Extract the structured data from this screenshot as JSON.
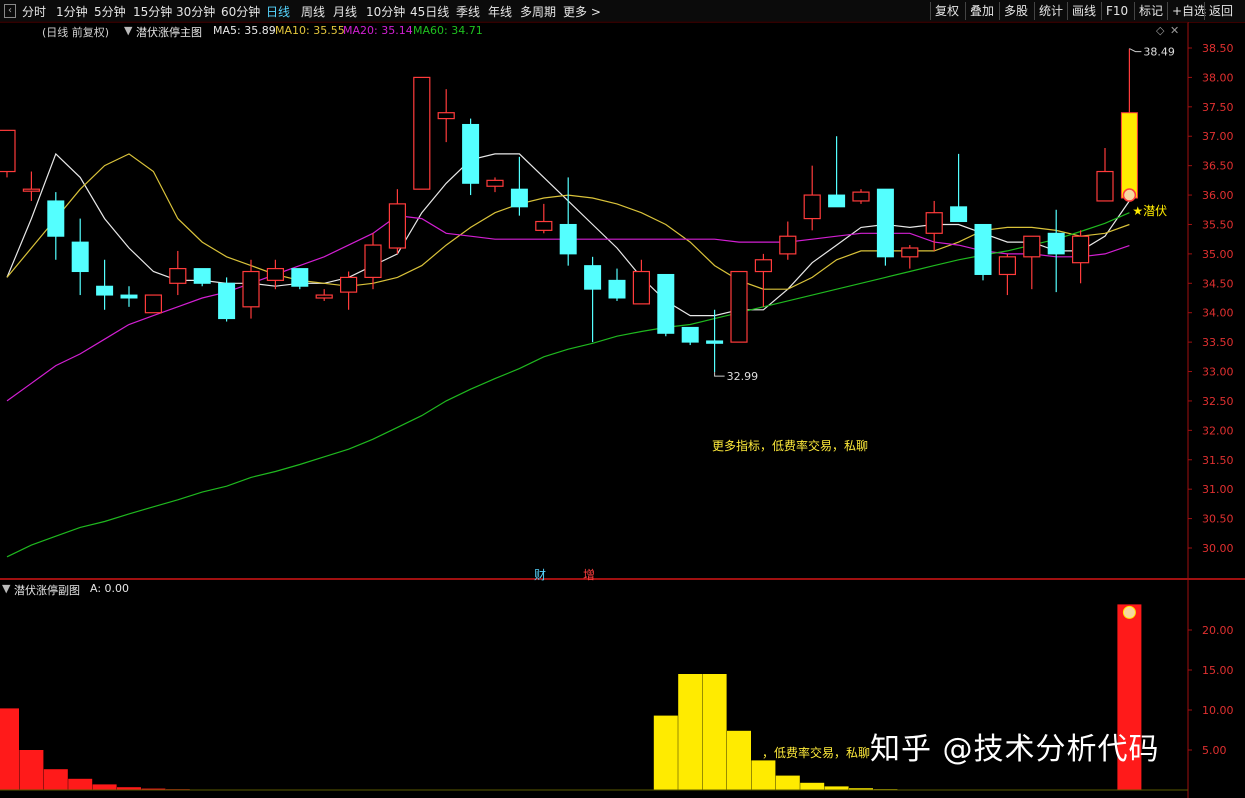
{
  "toolbar": {
    "periods": [
      "分时",
      "1分钟",
      "5分钟",
      "15分钟",
      "30分钟",
      "60分钟",
      "日线",
      "周线",
      "月线",
      "10分钟",
      "45日线",
      "季线",
      "年线",
      "多周期",
      "更多 >"
    ],
    "active_period": "日线",
    "right_buttons": [
      "复权",
      "叠加",
      "多股",
      "统计",
      "画线",
      "F10",
      "标记",
      "+自选",
      "返回"
    ]
  },
  "main_legend": {
    "title": "(日线 前复权)",
    "indicator": "潜伏涨停主图",
    "ma5_label": "MA5: 35.89",
    "ma10_label": "MA10: 35.55",
    "ma20_label": "MA20: 35.14",
    "ma60_label": "MA60: 34.71"
  },
  "sub_legend": {
    "indicator": "潜伏涨停副图",
    "value": "A: 0.00"
  },
  "colors": {
    "up": "#ff3b3b",
    "down": "#54ffff",
    "ma5": "#e8e8e8",
    "ma10": "#d9c23a",
    "ma20": "#d21fd2",
    "ma60": "#1fb81f",
    "signal": "#ffeb00",
    "axis": "#a01010"
  },
  "annotations": {
    "high_label": "38.49",
    "low_label": "32.99",
    "signal_label": "★潜伏",
    "promo_text": "更多指标，低费率交易，私聊",
    "promo_text_sub": "，低费率交易，私聊",
    "marker_cai": "财",
    "marker_zeng": "增",
    "watermark": "知乎 @技术分析代码"
  },
  "chart_data": [
    {
      "type": "candlestick",
      "title": "潜伏涨停主图",
      "ylim": [
        29.6,
        38.75
      ],
      "y_ticks": [
        "38.50",
        "38.00",
        "37.50",
        "37.00",
        "36.50",
        "36.00",
        "35.50",
        "35.00",
        "34.50",
        "34.00",
        "33.50",
        "33.00",
        "32.50",
        "32.00",
        "31.50",
        "31.00",
        "30.50",
        "30.00"
      ],
      "candles": [
        {
          "o": 36.4,
          "h": 37.0,
          "l": 36.3,
          "c": 37.1
        },
        {
          "o": 36.1,
          "h": 36.4,
          "l": 35.9,
          "c": 36.1
        },
        {
          "o": 35.9,
          "h": 36.05,
          "l": 34.9,
          "c": 35.3
        },
        {
          "o": 35.2,
          "h": 35.6,
          "l": 34.3,
          "c": 34.7
        },
        {
          "o": 34.45,
          "h": 34.9,
          "l": 34.05,
          "c": 34.3
        },
        {
          "o": 34.3,
          "h": 34.45,
          "l": 34.1,
          "c": 34.25
        },
        {
          "o": 34.0,
          "h": 34.3,
          "l": 34.0,
          "c": 34.3
        },
        {
          "o": 34.5,
          "h": 35.05,
          "l": 34.3,
          "c": 34.75
        },
        {
          "o": 34.75,
          "h": 34.75,
          "l": 34.45,
          "c": 34.5
        },
        {
          "o": 34.5,
          "h": 34.6,
          "l": 33.85,
          "c": 33.9
        },
        {
          "o": 34.1,
          "h": 34.9,
          "l": 33.9,
          "c": 34.7
        },
        {
          "o": 34.55,
          "h": 34.9,
          "l": 34.4,
          "c": 34.75
        },
        {
          "o": 34.75,
          "h": 34.75,
          "l": 34.4,
          "c": 34.45
        },
        {
          "o": 34.25,
          "h": 34.4,
          "l": 34.2,
          "c": 34.3
        },
        {
          "o": 34.35,
          "h": 34.7,
          "l": 34.05,
          "c": 34.6
        },
        {
          "o": 34.6,
          "h": 35.35,
          "l": 34.4,
          "c": 35.15
        },
        {
          "o": 35.1,
          "h": 36.1,
          "l": 35.0,
          "c": 35.85
        },
        {
          "o": 36.1,
          "h": 38.0,
          "l": 36.1,
          "c": 38.0
        },
        {
          "o": 37.3,
          "h": 37.8,
          "l": 36.9,
          "c": 37.4
        },
        {
          "o": 37.2,
          "h": 37.3,
          "l": 36.0,
          "c": 36.2
        },
        {
          "o": 36.15,
          "h": 36.3,
          "l": 36.05,
          "c": 36.25
        },
        {
          "o": 36.1,
          "h": 36.65,
          "l": 35.65,
          "c": 35.8
        },
        {
          "o": 35.4,
          "h": 35.85,
          "l": 35.35,
          "c": 35.55
        },
        {
          "o": 35.5,
          "h": 36.3,
          "l": 34.8,
          "c": 35.0
        },
        {
          "o": 34.8,
          "h": 34.95,
          "l": 33.5,
          "c": 34.4
        },
        {
          "o": 34.55,
          "h": 34.75,
          "l": 34.2,
          "c": 34.25
        },
        {
          "o": 34.15,
          "h": 34.9,
          "l": 34.15,
          "c": 34.7
        },
        {
          "o": 34.65,
          "h": 34.65,
          "l": 33.6,
          "c": 33.65
        },
        {
          "o": 33.75,
          "h": 33.75,
          "l": 33.45,
          "c": 33.5
        },
        {
          "o": 33.52,
          "h": 34.05,
          "l": 32.99,
          "c": 33.48
        },
        {
          "o": 33.5,
          "h": 34.7,
          "l": 33.5,
          "c": 34.7
        },
        {
          "o": 34.7,
          "h": 35.0,
          "l": 34.1,
          "c": 34.9
        },
        {
          "o": 35.0,
          "h": 35.55,
          "l": 34.9,
          "c": 35.3
        },
        {
          "o": 35.6,
          "h": 36.5,
          "l": 35.4,
          "c": 36.0
        },
        {
          "o": 36.0,
          "h": 37.0,
          "l": 35.8,
          "c": 35.8
        },
        {
          "o": 35.9,
          "h": 36.1,
          "l": 35.85,
          "c": 36.05
        },
        {
          "o": 36.1,
          "h": 36.1,
          "l": 34.8,
          "c": 34.95
        },
        {
          "o": 34.95,
          "h": 35.15,
          "l": 34.75,
          "c": 35.1
        },
        {
          "o": 35.35,
          "h": 35.9,
          "l": 35.05,
          "c": 35.7
        },
        {
          "o": 35.8,
          "h": 36.7,
          "l": 35.55,
          "c": 35.55
        },
        {
          "o": 35.5,
          "h": 35.5,
          "l": 34.55,
          "c": 34.65
        },
        {
          "o": 34.65,
          "h": 35.0,
          "l": 34.3,
          "c": 34.95
        },
        {
          "o": 34.95,
          "h": 35.05,
          "l": 34.4,
          "c": 35.3
        },
        {
          "o": 35.35,
          "h": 35.75,
          "l": 34.35,
          "c": 35.0
        },
        {
          "o": 34.85,
          "h": 35.4,
          "l": 34.5,
          "c": 35.3
        },
        {
          "o": 35.9,
          "h": 36.8,
          "l": 35.9,
          "c": 36.4
        },
        {
          "o": 35.95,
          "h": 38.49,
          "l": 35.95,
          "c": 37.4
        }
      ],
      "series": [
        {
          "name": "MA5",
          "values": [
            34.6,
            35.6,
            36.7,
            36.3,
            35.6,
            35.1,
            34.7,
            34.55,
            34.55,
            34.5,
            34.5,
            34.45,
            34.5,
            34.5,
            34.6,
            34.8,
            35.0,
            35.7,
            36.2,
            36.6,
            36.7,
            36.7,
            36.3,
            35.9,
            35.5,
            35.1,
            34.6,
            34.2,
            33.95,
            33.95,
            34.05,
            34.05,
            34.4,
            34.85,
            35.15,
            35.45,
            35.5,
            35.45,
            35.5,
            35.5,
            35.35,
            35.2,
            35.2,
            35.05,
            35.05,
            35.3,
            35.9
          ]
        },
        {
          "name": "MA10",
          "values": [
            34.6,
            35.1,
            35.6,
            36.1,
            36.5,
            36.7,
            36.4,
            35.6,
            35.2,
            34.95,
            34.8,
            34.65,
            34.55,
            34.5,
            34.45,
            34.5,
            34.6,
            34.8,
            35.15,
            35.45,
            35.7,
            35.85,
            35.95,
            36.0,
            35.95,
            35.85,
            35.7,
            35.5,
            35.2,
            34.8,
            34.55,
            34.4,
            34.4,
            34.6,
            34.9,
            35.05,
            35.05,
            35.05,
            35.05,
            35.2,
            35.4,
            35.45,
            35.45,
            35.4,
            35.3,
            35.35,
            35.5
          ]
        },
        {
          "name": "MA20",
          "values": [
            32.5,
            32.8,
            33.1,
            33.3,
            33.55,
            33.8,
            33.95,
            34.1,
            34.25,
            34.35,
            34.5,
            34.65,
            34.8,
            34.95,
            35.15,
            35.35,
            35.65,
            35.6,
            35.35,
            35.3,
            35.25,
            35.25,
            35.25,
            35.25,
            35.25,
            35.25,
            35.25,
            35.25,
            35.25,
            35.25,
            35.2,
            35.2,
            35.2,
            35.25,
            35.3,
            35.35,
            35.35,
            35.35,
            35.2,
            35.15,
            35.05,
            35.0,
            35.0,
            34.95,
            34.95,
            35.0,
            35.14
          ]
        },
        {
          "name": "MA60",
          "values": [
            29.85,
            30.05,
            30.2,
            30.35,
            30.45,
            30.58,
            30.7,
            30.82,
            30.95,
            31.05,
            31.2,
            31.3,
            31.42,
            31.55,
            31.68,
            31.85,
            32.05,
            32.25,
            32.5,
            32.7,
            32.88,
            33.05,
            33.25,
            33.38,
            33.48,
            33.6,
            33.68,
            33.75,
            33.8,
            33.9,
            34.0,
            34.1,
            34.2,
            34.3,
            34.4,
            34.5,
            34.6,
            34.7,
            34.8,
            34.9,
            34.98,
            35.05,
            35.15,
            35.25,
            35.38,
            35.52,
            35.7
          ]
        }
      ]
    },
    {
      "type": "bar",
      "title": "潜伏涨停副图",
      "ylim": [
        0,
        24
      ],
      "y_ticks": [
        "20.00",
        "15.00",
        "10.00",
        "5.00"
      ],
      "values": [
        10.2,
        5.0,
        2.6,
        1.4,
        0.7,
        0.35,
        0.18,
        0.1,
        0.05,
        0.03,
        0.02,
        0.01,
        0,
        0,
        0,
        0,
        0,
        0,
        0,
        0,
        0,
        0,
        0,
        0,
        0,
        0,
        0,
        9.3,
        14.5,
        14.5,
        7.4,
        3.7,
        1.8,
        0.9,
        0.45,
        0.22,
        0.1,
        0.05,
        0.02,
        0,
        0,
        0,
        0,
        0,
        0,
        0,
        23.2
      ],
      "colors": [
        "red",
        "red",
        "red",
        "red",
        "red",
        "red",
        "red",
        "red",
        "red",
        "red",
        "red",
        "red",
        "red",
        "red",
        "red",
        "red",
        "red",
        "red",
        "red",
        "red",
        "red",
        "red",
        "red",
        "red",
        "red",
        "red",
        "red",
        "yellow",
        "yellow",
        "yellow",
        "yellow",
        "yellow",
        "yellow",
        "yellow",
        "yellow",
        "yellow",
        "yellow",
        "yellow",
        "yellow",
        "yellow",
        "yellow",
        "yellow",
        "yellow",
        "yellow",
        "yellow",
        "yellow",
        "red"
      ]
    }
  ]
}
